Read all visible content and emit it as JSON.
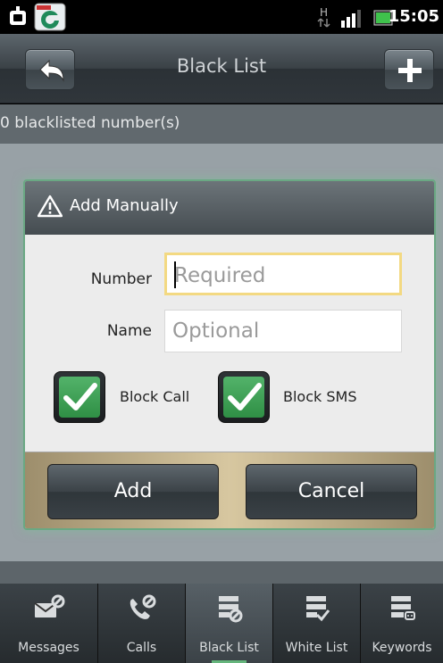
{
  "status_bar": {
    "time": "15:05",
    "network_type": "H",
    "icons": [
      "android-debug-icon",
      "app-notification-icon",
      "hspa-icon",
      "signal-icon",
      "battery-icon"
    ]
  },
  "title_bar": {
    "title": "Black List",
    "back_icon": "back-arrow-icon",
    "add_icon": "plus-icon"
  },
  "list": {
    "count_text": "0 blacklisted number(s)"
  },
  "dialog": {
    "title": "Add Manually",
    "title_icon": "warning-icon",
    "number_label": "Number",
    "number_placeholder": "Required",
    "number_value": "",
    "name_label": "Name",
    "name_placeholder": "Optional",
    "name_value": "",
    "block_call_label": "Block Call",
    "block_call_checked": true,
    "block_sms_label": "Block SMS",
    "block_sms_checked": true,
    "add_label": "Add",
    "cancel_label": "Cancel"
  },
  "tabs": [
    {
      "label": "Messages",
      "icon": "message-block-icon",
      "active": false
    },
    {
      "label": "Calls",
      "icon": "phone-block-icon",
      "active": false
    },
    {
      "label": "Black List",
      "icon": "blacklist-icon",
      "active": true
    },
    {
      "label": "White List",
      "icon": "whitelist-icon",
      "active": false
    },
    {
      "label": "Keywords",
      "icon": "keywords-icon",
      "active": false
    }
  ],
  "colors": {
    "accent_green": "#65b57c",
    "checkbox_green": "#3fa055",
    "field_focus": "#f3d982"
  }
}
